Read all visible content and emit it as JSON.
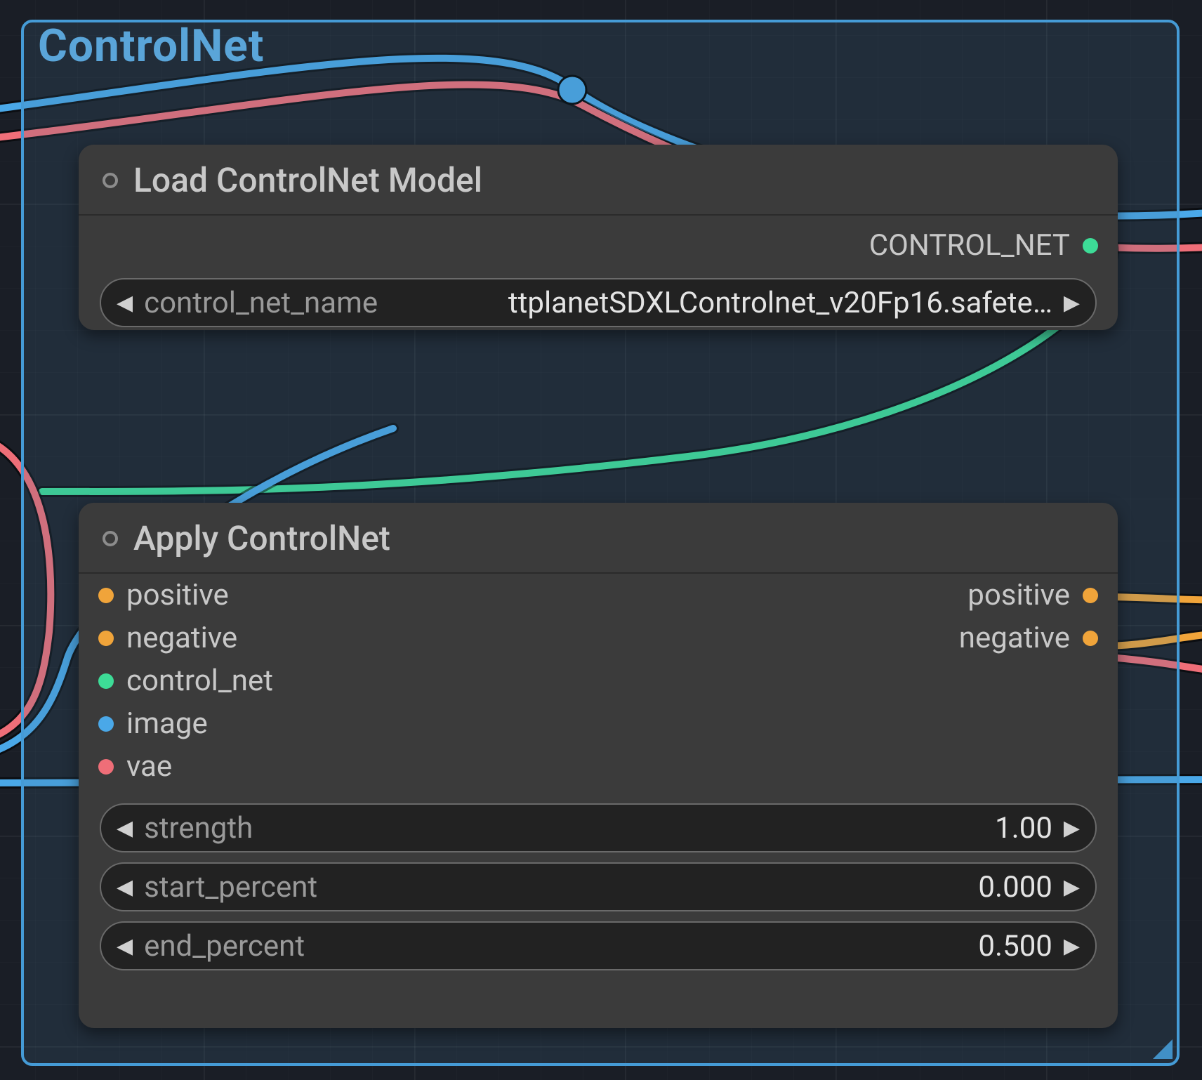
{
  "group": {
    "title": "ControlNet"
  },
  "colors": {
    "teal": "#3ddc97",
    "orange": "#f0a43a",
    "blue": "#4aa8e8",
    "pink": "#ef6e78"
  },
  "nodes": {
    "load": {
      "title": "Load ControlNet Model",
      "outputs": [
        {
          "label": "CONTROL_NET",
          "color": "teal"
        }
      ],
      "params": [
        {
          "name": "control_net_name",
          "value": "ttplanetSDXLControlnet_v20Fp16.safete…"
        }
      ]
    },
    "apply": {
      "title": "Apply ControlNet",
      "inputs": [
        {
          "label": "positive",
          "color": "orange"
        },
        {
          "label": "negative",
          "color": "orange"
        },
        {
          "label": "control_net",
          "color": "teal"
        },
        {
          "label": "image",
          "color": "blue"
        },
        {
          "label": "vae",
          "color": "pink"
        }
      ],
      "outputs": [
        {
          "label": "positive",
          "color": "orange"
        },
        {
          "label": "negative",
          "color": "orange"
        }
      ],
      "params": [
        {
          "name": "strength",
          "value": "1.00"
        },
        {
          "name": "start_percent",
          "value": "0.000"
        },
        {
          "name": "end_percent",
          "value": "0.500"
        }
      ]
    }
  }
}
